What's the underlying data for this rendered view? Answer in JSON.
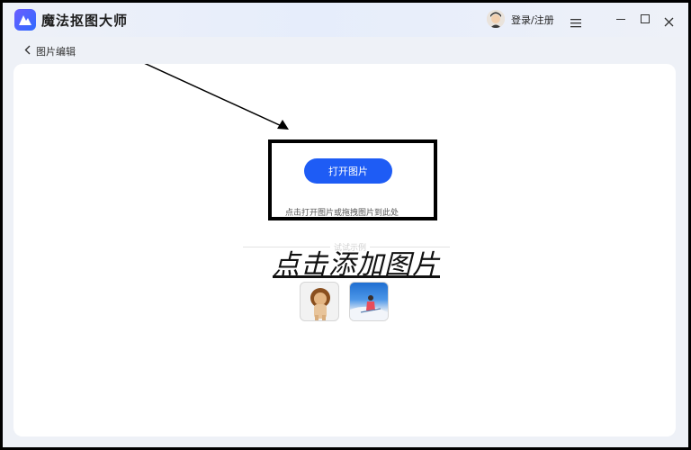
{
  "app": {
    "title": "魔法抠图大师",
    "login_label": "登录/注册"
  },
  "icons": {
    "logo": "app-logo-icon",
    "menu": "hamburger-menu-icon",
    "minimize": "minimize-icon",
    "maximize": "maximize-icon",
    "close": "close-icon",
    "back": "chevron-left-icon"
  },
  "breadcrumb": {
    "label": "图片编辑"
  },
  "upload": {
    "button_label": "打开图片",
    "hint": "点击打开图片或拖拽图片到此处",
    "sample_label": "试试示例"
  },
  "annotation": {
    "caption": "点击添加图片"
  },
  "samples": [
    {
      "name": "lion-sample"
    },
    {
      "name": "snow-sample"
    }
  ],
  "colors": {
    "accent": "#1e5cf5",
    "background": "#eef1f7",
    "panel": "#ffffff"
  }
}
